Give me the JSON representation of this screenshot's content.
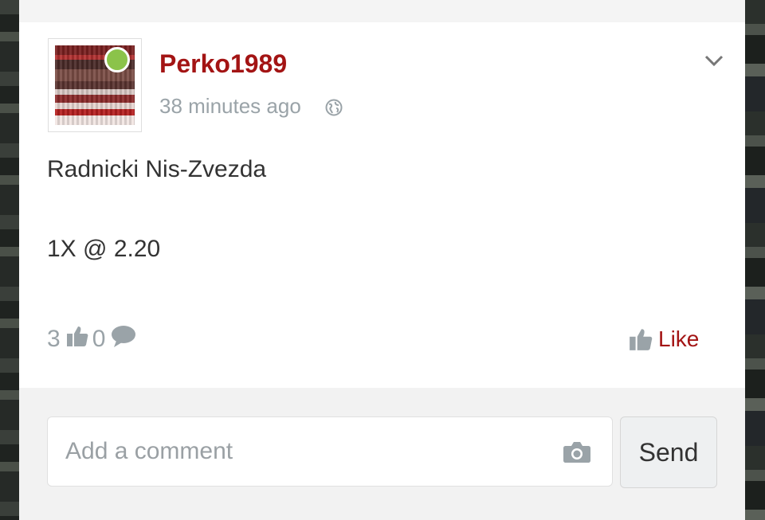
{
  "post": {
    "author": "Perko1989",
    "time": "38 minutes ago",
    "lines": [
      "Radnicki Nis-Zvezda",
      "1X @ 2.20"
    ],
    "like_count": "3",
    "comment_count": "0",
    "like_label": "Like"
  },
  "comment_box": {
    "placeholder": "Add a comment",
    "send_label": "Send"
  },
  "colors": {
    "accent": "#a31414",
    "online": "#8bc34a",
    "muted": "#9aa3a8"
  },
  "icons": [
    "globe-icon",
    "chevron-down-icon",
    "thumbs-up-icon",
    "comment-bubble-icon",
    "camera-icon"
  ]
}
